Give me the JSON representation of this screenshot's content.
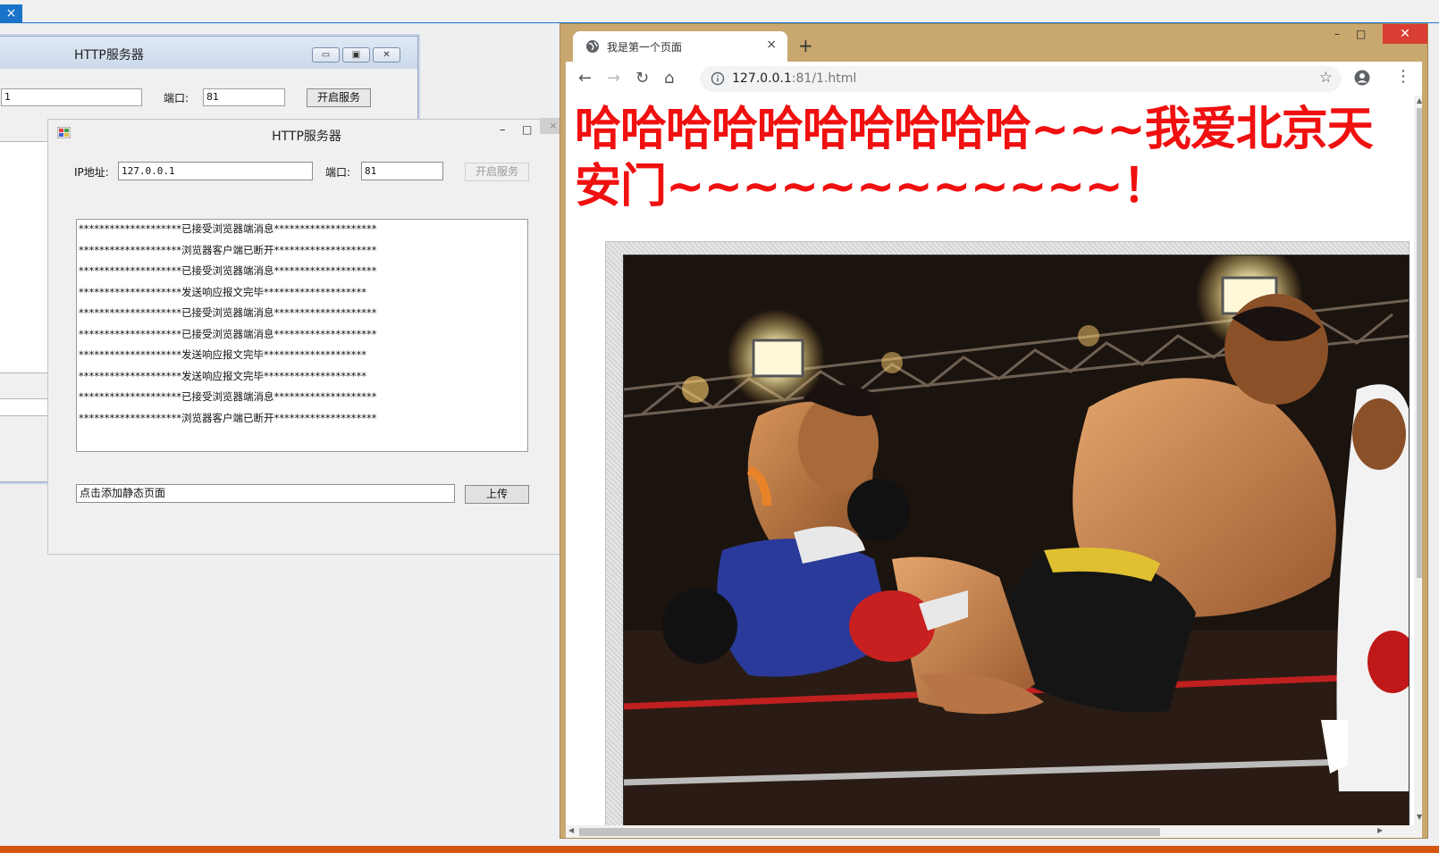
{
  "desktop": {
    "top_close_icon": "×"
  },
  "window_back": {
    "title": "HTTP服务器",
    "ip_value": "1",
    "port_label": "端口:",
    "port_value": "81",
    "start_button": "开启服务",
    "controls": {
      "min": "▭",
      "max": "▣",
      "close": "✕"
    }
  },
  "window_front": {
    "title": "HTTP服务器",
    "ip_label": "IP地址:",
    "ip_value": "127.0.0.1",
    "port_label": "端口:",
    "port_value": "81",
    "start_button": "开启服务",
    "log_lines": [
      "********************已接受浏览器端消息********************",
      "********************浏览器客户端已断开********************",
      "********************已接受浏览器端消息********************",
      "********************发送响应报文完毕********************",
      "********************已接受浏览器端消息********************",
      "********************已接受浏览器端消息********************",
      "********************发送响应报文完毕********************",
      "********************发送响应报文完毕********************",
      "********************已接受浏览器端消息********************",
      "********************浏览器客户端已断开********************"
    ],
    "file_field": "点击添加静态页面",
    "upload_button": "上传",
    "controls": {
      "min": "–",
      "max": "□",
      "close": "×"
    }
  },
  "browser": {
    "tab_title": "我是第一个页面",
    "tab_close": "×",
    "new_tab": "+",
    "window_controls": {
      "min": "–",
      "max": "□",
      "close": "✕"
    },
    "url_host": "127.0.0.1",
    "url_rest": ":81/1.html",
    "heading": "哈哈哈哈哈哈哈哈哈哈~~~我爱北京天安门~~~~~~~~~~~~！",
    "nav": {
      "back": "←",
      "forward": "→",
      "reload": "↻",
      "home": "⌂",
      "star": "☆",
      "menu": "⋮"
    },
    "scroll_arrows": {
      "up": "▲",
      "down": "▼",
      "left": "◀",
      "right": "▶"
    }
  },
  "colors": {
    "heading_red": "#f01010",
    "browser_frame": "#c9a870",
    "close_red": "#d93e33",
    "taskbar_orange": "#d4570f",
    "accent_blue": "#1a73c8"
  }
}
